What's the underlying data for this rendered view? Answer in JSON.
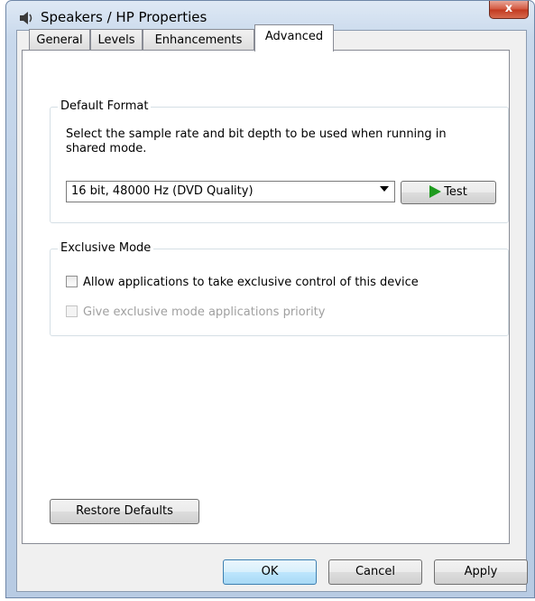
{
  "window": {
    "title": "Speakers / HP Properties",
    "close_glyph": "x"
  },
  "tabs": [
    {
      "label": "General",
      "active": false
    },
    {
      "label": "Levels",
      "active": false
    },
    {
      "label": "Enhancements",
      "active": false
    },
    {
      "label": "Advanced",
      "active": true
    }
  ],
  "default_format": {
    "legend": "Default Format",
    "description": "Select the sample rate and bit depth to be used when running in shared mode.",
    "selected_format": "16 bit, 48000 Hz (DVD Quality)",
    "test_label": "Test"
  },
  "exclusive_mode": {
    "legend": "Exclusive Mode",
    "allow_exclusive": {
      "label": "Allow applications to take exclusive control of this device",
      "checked": false,
      "enabled": true
    },
    "priority": {
      "label": "Give exclusive mode applications priority",
      "checked": false,
      "enabled": false
    }
  },
  "restore_defaults_label": "Restore Defaults",
  "footer": {
    "ok_label": "OK",
    "cancel_label": "Cancel",
    "apply_label": "Apply"
  },
  "colors": {
    "test_icon": "#1f9b1f",
    "close_button": "#c1391f",
    "title_bar": "#c9d9ec"
  },
  "icons": {
    "title": "speaker-icon",
    "test": "play-icon",
    "close": "close-icon",
    "dropdown": "chevron-down-icon"
  }
}
